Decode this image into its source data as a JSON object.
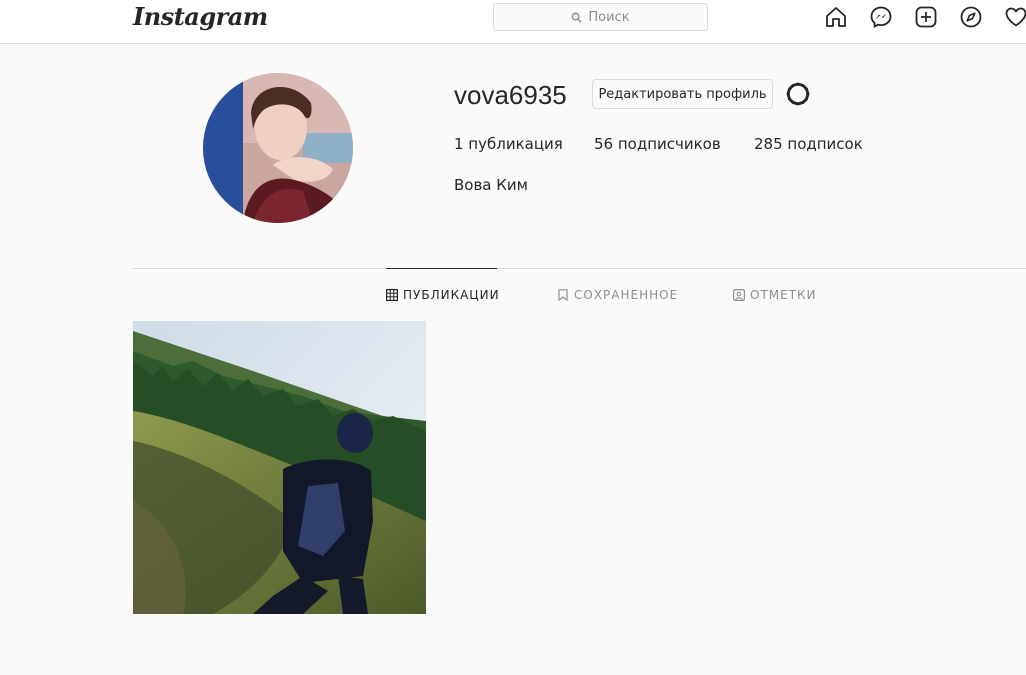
{
  "app": {
    "logo_text": "Instagram"
  },
  "search": {
    "placeholder": "Поиск",
    "icon": "search-icon"
  },
  "nav_icons": [
    "home-icon",
    "messenger-icon",
    "new-post-icon",
    "explore-icon",
    "activity-heart-icon"
  ],
  "profile": {
    "username": "vova6935",
    "edit_button": "Редактировать профиль",
    "stats": {
      "posts": "1 публикация",
      "followers": "56 подписчиков",
      "following": "285 подписок"
    },
    "full_name": "Вова Ким"
  },
  "tabs": [
    {
      "label": "ПУБЛИКАЦИИ",
      "icon": "grid-icon",
      "active": true
    },
    {
      "label": "СОХРАНЕННОЕ",
      "icon": "bookmark-icon",
      "active": false
    },
    {
      "label": "ОТМЕТКИ",
      "icon": "tagged-icon",
      "active": false
    }
  ],
  "colors": {
    "border": "#dbdbdb",
    "text": "#262626",
    "muted": "#8e8e8e",
    "background": "#fafafa"
  }
}
